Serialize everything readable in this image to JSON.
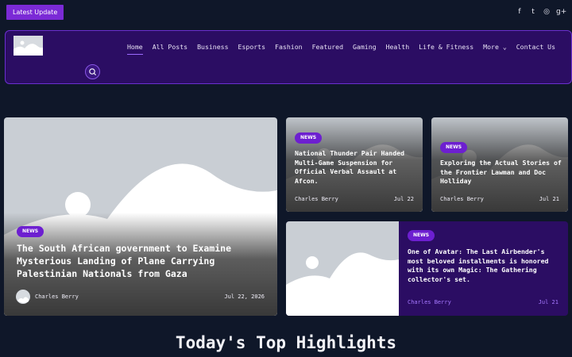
{
  "topbar": {
    "latest_label": "Latest Update",
    "social_icons": [
      "facebook-icon",
      "twitter-icon",
      "instagram-icon",
      "google-plus-icon"
    ],
    "social_glyphs": [
      "f",
      "t",
      "◎",
      "g+"
    ]
  },
  "nav": {
    "items": [
      "Home",
      "All Posts",
      "Business",
      "Esports",
      "Fashion",
      "Featured",
      "Gaming",
      "Health",
      "Life & Fitness",
      "More ⌄",
      "Contact Us"
    ],
    "active": "Home"
  },
  "main_card": {
    "badge": "NEWS",
    "title": "The South African government to Examine Mysterious Landing of Plane Carrying Palestinian Nationals from Gaza",
    "author": "Charles Berry",
    "date": "Jul 22, 2026"
  },
  "card2": {
    "badge": "NEWS",
    "title": "National Thunder Pair Handed Multi-Game Suspension for Official Verbal Assault at Afcon.",
    "author": "Charles Berry",
    "date": "Jul 22"
  },
  "card3": {
    "badge": "NEWS",
    "title": "Exploring the Actual Stories of the Frontier Lawman and Doc Holliday",
    "author": "Charles Berry",
    "date": "Jul 21"
  },
  "card4": {
    "badge": "NEWS",
    "title": "One of Avatar: The Last Airbender's most beloved installments is honored with its own Magic: The Gathering collector's set.",
    "author": "Charles Berry",
    "date": "Jul 21"
  },
  "section": {
    "title": "Today's Top Highlights"
  },
  "colors": {
    "accent": "#6d1fd0",
    "header_bg": "#2b0d63",
    "page_bg": "#0f1729"
  }
}
